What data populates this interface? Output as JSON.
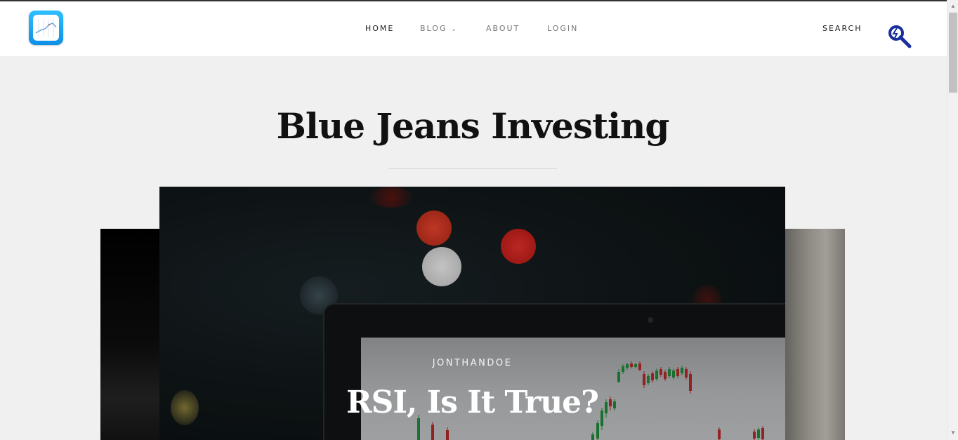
{
  "nav": {
    "items": [
      {
        "label": "HOME",
        "active": true
      },
      {
        "label": "BLOG",
        "has_dropdown": true
      },
      {
        "label": "ABOUT"
      },
      {
        "label": "LOGIN"
      }
    ],
    "search_label": "SEARCH"
  },
  "site": {
    "title": "Blue Jeans Investing"
  },
  "featured_post": {
    "author": "JONTHANDOE",
    "title": "RSI, Is It True?"
  },
  "colors": {
    "logo_gradient_top": "#2ec0ff",
    "logo_gradient_bottom": "#0d8fe6",
    "search_icon": "#1a2f9e",
    "candle_up": "#1f8a3a",
    "candle_down": "#b42a2a"
  },
  "icons": {
    "logo": "chart-app-icon",
    "search": "magnifier-search-icon",
    "dropdown": "chevron-down-icon"
  }
}
